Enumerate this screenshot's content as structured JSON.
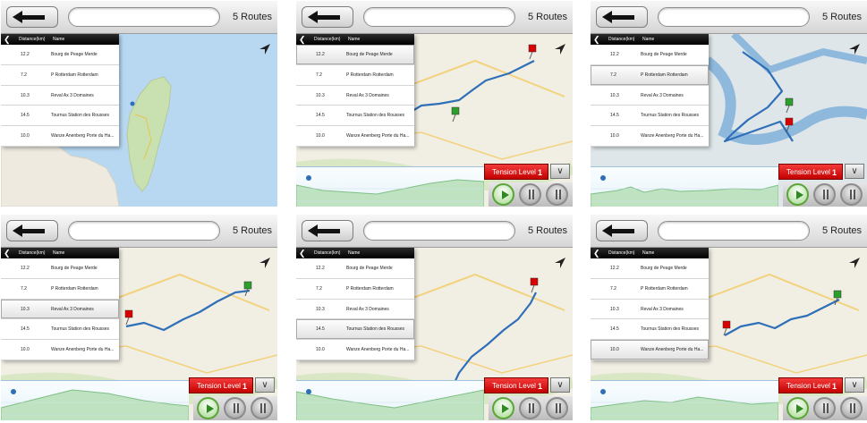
{
  "routes_label": "5 Routes",
  "list": {
    "col_distance": "Distance(km)",
    "col_name": "Name",
    "rows": [
      {
        "distance": "12.2",
        "name": "Bourg de Peage Merde"
      },
      {
        "distance": "7.2",
        "name": "P Rotterdam  Rotterdam"
      },
      {
        "distance": "10.3",
        "name": "Reval Ax 3 Domaines"
      },
      {
        "distance": "14.5",
        "name": "Tournus Station des Rousses"
      },
      {
        "distance": "10.0",
        "name": "Wanze Anenberg Porte du Ha..."
      }
    ]
  },
  "tension": {
    "label": "Tension Level",
    "value": "1"
  },
  "icons": {
    "back": "back-arrow-icon",
    "close": "close-icon",
    "locate": "navigation-arrow-icon",
    "collapse": "chevron-down-icon",
    "play": "play-icon"
  },
  "colors": {
    "route": "#2f6fb8",
    "tension": "#d90000",
    "elevation_fill": "#bfe3c1",
    "water": "#b8d8f2",
    "land": "#eeeae0"
  },
  "panels": [
    {
      "id": "taiwan",
      "selected_row": -1,
      "show_list": true,
      "show_elevation": false
    },
    {
      "id": "route-1",
      "selected_row": 0,
      "show_list": true,
      "show_elevation": true
    },
    {
      "id": "route-2",
      "selected_row": 1,
      "show_list": true,
      "show_elevation": true
    },
    {
      "id": "route-3",
      "selected_row": 2,
      "show_list": true,
      "show_elevation": true
    },
    {
      "id": "route-4",
      "selected_row": 3,
      "show_list": true,
      "show_elevation": true
    },
    {
      "id": "route-5",
      "selected_row": 4,
      "show_list": true,
      "show_elevation": true
    }
  ]
}
